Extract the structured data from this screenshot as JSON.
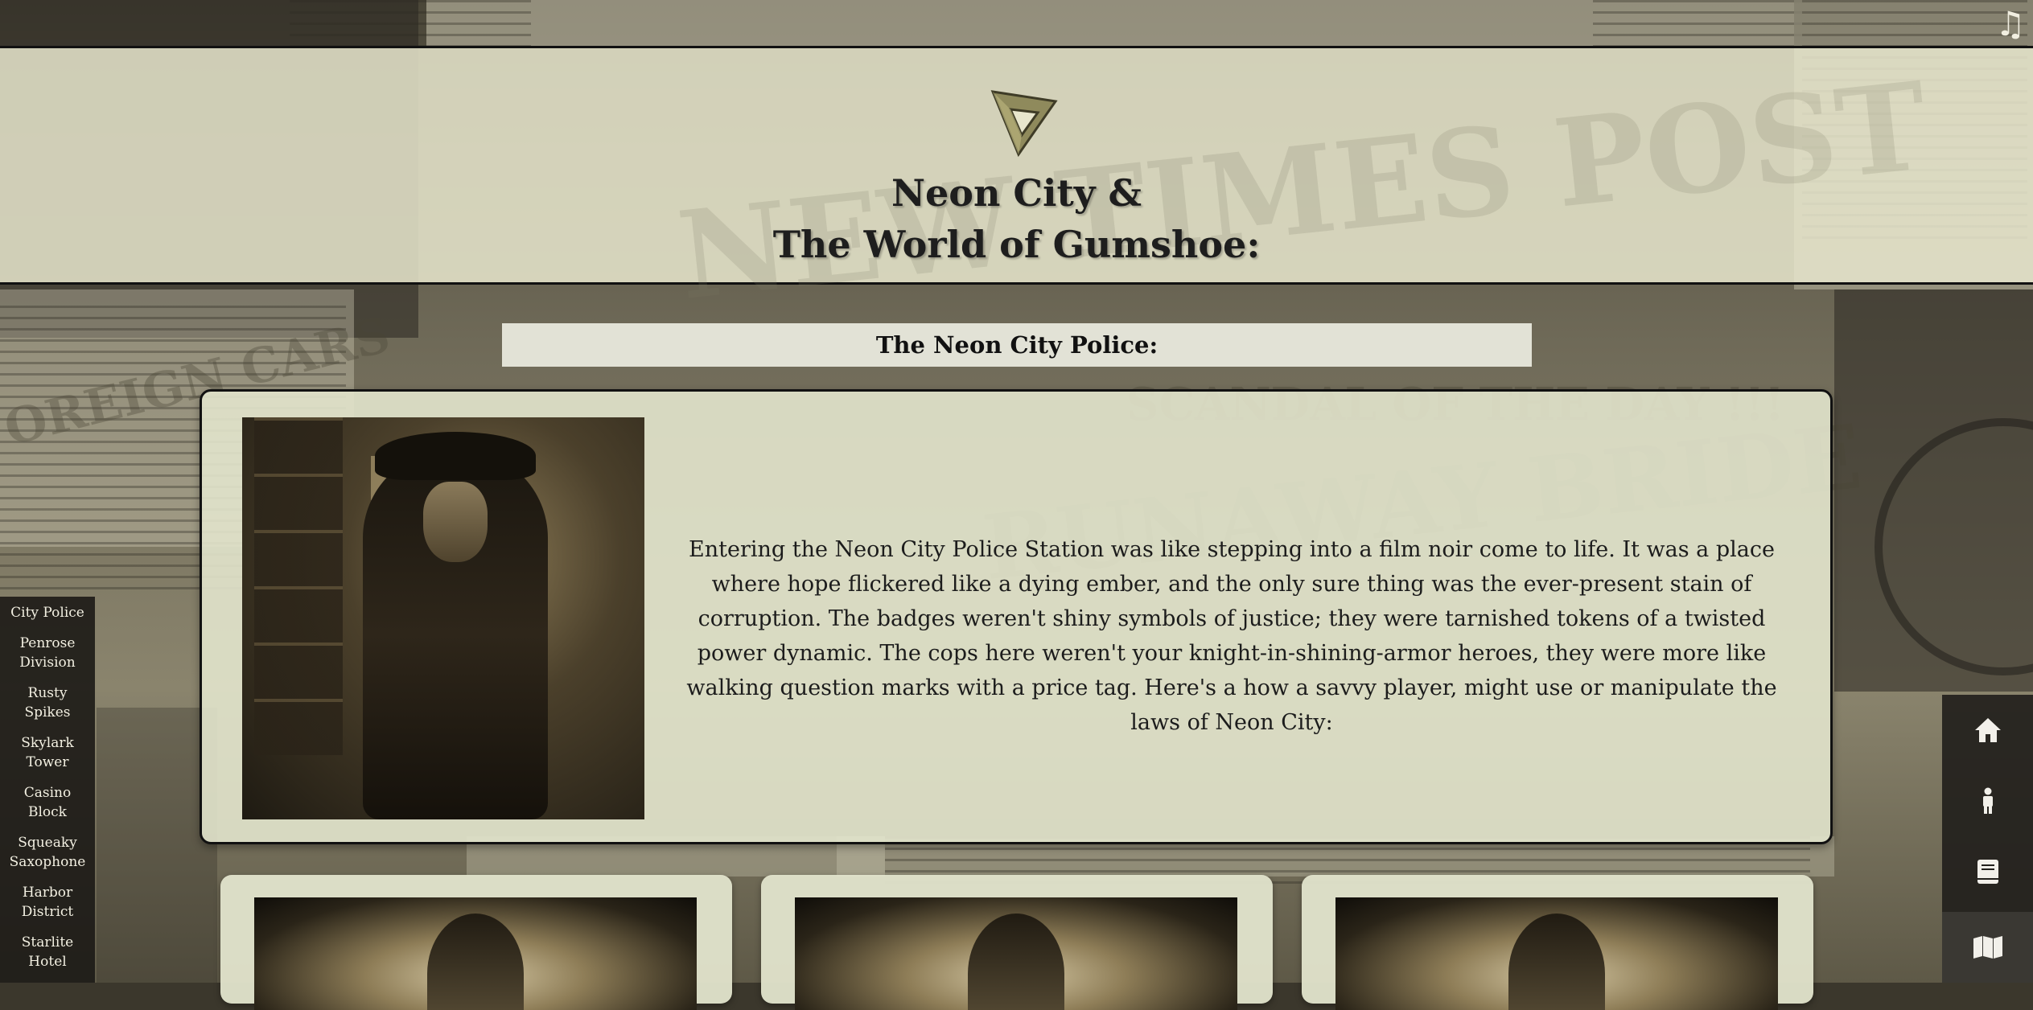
{
  "header": {
    "logo_icon": "triangle-logo-icon",
    "title_line1": "Neon City &",
    "title_line2": "The World of Gumshoe:",
    "music_icon": "music-note-icon"
  },
  "section": {
    "heading": "The Neon City Police:"
  },
  "intro": {
    "text": "Entering the Neon City Police Station was like stepping into a film noir come to life. It was a place where hope flickered like a dying ember, and the only sure thing was the ever-present stain of corruption. The badges weren't shiny symbols of justice; they were tarnished tokens of a twisted power dynamic. The cops here weren't your knight-in-shining-armor heroes, they were more like walking question marks with a price tag. Here's a how a savvy player, might use or manipulate the laws of Neon City:"
  },
  "sidenav": {
    "items": [
      {
        "label": "City Police"
      },
      {
        "label": "Penrose Division"
      },
      {
        "label": "Rusty Spikes"
      },
      {
        "label": "Skylark Tower"
      },
      {
        "label": "Casino Block"
      },
      {
        "label": "Squeaky Saxophone"
      },
      {
        "label": "Harbor District"
      },
      {
        "label": "Starlite Hotel"
      }
    ]
  },
  "iconbar": {
    "items": [
      {
        "icon": "home-icon"
      },
      {
        "icon": "person-icon"
      },
      {
        "icon": "book-icon"
      },
      {
        "icon": "map-icon",
        "active": true
      }
    ]
  },
  "colors": {
    "header_bg": "#e8e6cd",
    "card_bg": "#e2e4cc",
    "nav_bg": "#1c1a16",
    "text": "#1c1c1c"
  }
}
